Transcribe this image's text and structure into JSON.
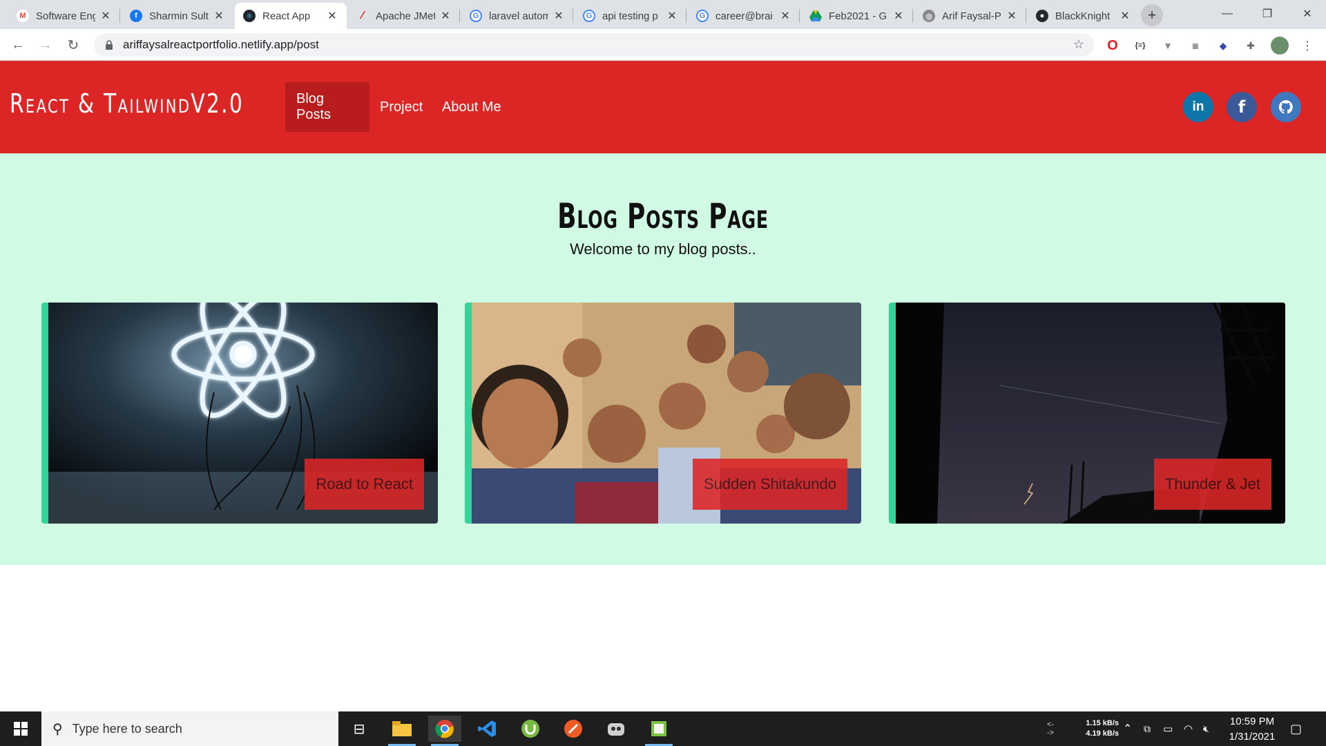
{
  "browser": {
    "tabs": [
      {
        "title": "Software Eng",
        "icon": "gmail-icon",
        "color": "#ea4335"
      },
      {
        "title": "Sharmin Sult",
        "icon": "facebook-icon",
        "color": "#1877f2"
      },
      {
        "title": "React App",
        "icon": "react-icon",
        "color": "#20232a",
        "active": true
      },
      {
        "title": "Apache JMet",
        "icon": "jmeter-icon",
        "color": "#d22128"
      },
      {
        "title": "laravel autom",
        "icon": "google-icon",
        "color": "#4285f4"
      },
      {
        "title": "api testing p",
        "icon": "google-icon",
        "color": "#4285f4"
      },
      {
        "title": "career@brai",
        "icon": "google-icon",
        "color": "#4285f4"
      },
      {
        "title": "Feb2021 - G",
        "icon": "google-drive-icon",
        "color": "#0f9d58"
      },
      {
        "title": "Arif Faysal-P",
        "icon": "globe-icon",
        "color": "#8a8a8a"
      },
      {
        "title": "BlackKnight",
        "icon": "github-icon",
        "color": "#24292e"
      }
    ],
    "url": "ariffaysalreactportfolio.netlify.app/post"
  },
  "site": {
    "brand": "React & TailwindV2.0",
    "nav": [
      {
        "label": "Blog Posts",
        "active": true
      },
      {
        "label": "Project",
        "active": false
      },
      {
        "label": "About Me",
        "active": false
      }
    ],
    "social": [
      {
        "name": "linkedin",
        "glyph": "in",
        "color": "#0e76a8"
      },
      {
        "name": "facebook",
        "glyph": "f",
        "color": "#3b5998"
      },
      {
        "name": "github",
        "glyph": "",
        "color": "#4078c0"
      }
    ]
  },
  "page": {
    "title": "Blog Posts Page",
    "subtitle": "Welcome to my blog posts.."
  },
  "posts": [
    {
      "title": "Road to React",
      "image": "react-neon-logo"
    },
    {
      "title": "Sudden Shitakundo",
      "image": "group-selfie"
    },
    {
      "title": "Thunder & Jet",
      "image": "night-lightning-sky"
    }
  ],
  "taskbar": {
    "search_placeholder": "Type here to search",
    "net_up": "1.15 kB/s",
    "net_down": "4.19 kB/s",
    "time": "10:59 PM",
    "date": "1/31/2021",
    "apps": [
      "task-view",
      "file-explorer",
      "chrome",
      "vs-code",
      "utorrent",
      "postman",
      "unknown-app",
      "notepad-app"
    ]
  }
}
